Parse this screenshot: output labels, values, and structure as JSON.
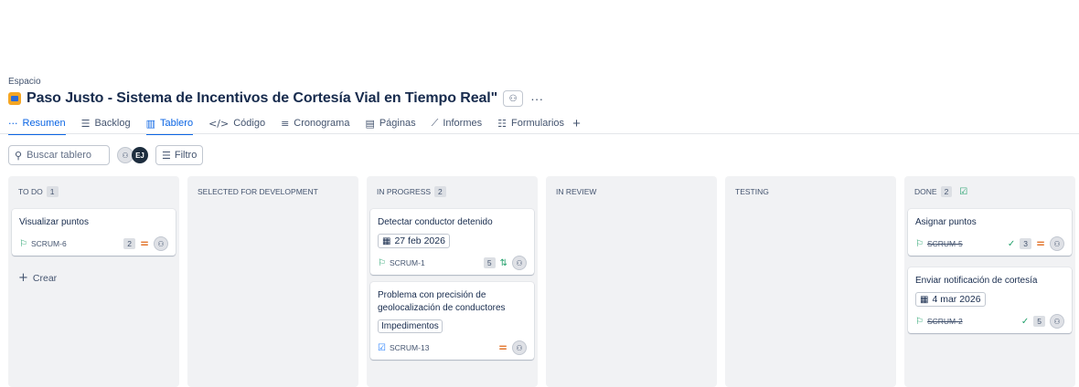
{
  "header": {
    "space_label": "Espacio",
    "project_title": "Paso Justo - Sistema de Incentivos de Cortesía Vial en Tiempo Real\"",
    "more": "···"
  },
  "tabs": [
    {
      "label": "Resumen",
      "icon": "···"
    },
    {
      "label": "Backlog",
      "icon": "☰"
    },
    {
      "label": "Tablero",
      "icon": "▥"
    },
    {
      "label": "Código",
      "icon": "</>"
    },
    {
      "label": "Cronograma",
      "icon": "≡"
    },
    {
      "label": "Páginas",
      "icon": "▤"
    },
    {
      "label": "Informes",
      "icon": "⟋"
    },
    {
      "label": "Formularios",
      "icon": "☷"
    }
  ],
  "toolbar": {
    "search_placeholder": "Buscar tablero",
    "avatar_initials": "EJ",
    "filter_label": "Filtro"
  },
  "columns": [
    {
      "name": "TO DO",
      "count": "1"
    },
    {
      "name": "SELECTED FOR DEVELOPMENT",
      "count": ""
    },
    {
      "name": "IN PROGRESS",
      "count": "2"
    },
    {
      "name": "IN REVIEW",
      "count": ""
    },
    {
      "name": "TESTING",
      "count": ""
    },
    {
      "name": "DONE",
      "count": "2"
    }
  ],
  "cards": {
    "c1": {
      "title": "Visualizar puntos",
      "key": "SCRUM-6",
      "points": "2"
    },
    "c2": {
      "title": "Detectar conductor detenido",
      "date": "27 feb 2026",
      "key": "SCRUM-1",
      "points": "5"
    },
    "c3": {
      "title": "Problema con precisión de geolocalización de conductores",
      "tag": "Impedimentos",
      "key": "SCRUM-13"
    },
    "c4": {
      "title": "Asignar puntos",
      "key": "SCRUM-5",
      "points": "3"
    },
    "c5": {
      "title": "Enviar notificación de cortesía",
      "date": "4 mar 2026",
      "key": "SCRUM-2",
      "points": "5"
    }
  },
  "create_label": "Crear",
  "colors": {
    "accent": "#0c66e4",
    "story": "#22a06b",
    "priority": "#e2742b"
  }
}
